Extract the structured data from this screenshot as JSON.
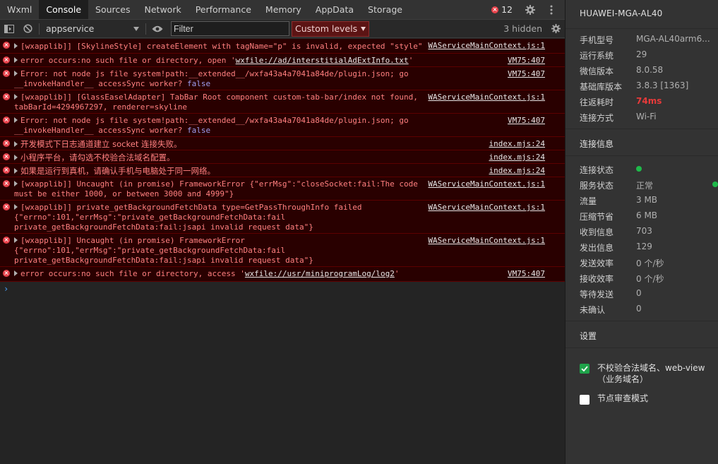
{
  "tabs": [
    "Wxml",
    "Console",
    "Sources",
    "Network",
    "Performance",
    "Memory",
    "AppData",
    "Storage"
  ],
  "active_tab": "Console",
  "error_count": "12",
  "toolbar": {
    "context": "appservice",
    "filter_placeholder": "Filter",
    "levels_label": "Custom levels",
    "hidden_label": "3 hidden"
  },
  "console": {
    "rows": [
      {
        "msg": "[wxapplib]] [SkylineStyle] createElement with tagName=\"p\" is invalid, expected \"style\"",
        "source": "WAServiceMainContext.js:1"
      },
      {
        "msg_prefix": "error occurs:no such file or directory, open '",
        "link": "wxfile://ad/interstitialAdExtInfo.txt",
        "msg_suffix": "'",
        "source": "VM75:407"
      },
      {
        "msg": "Error: not node js file system!path:__extended__/wxfa43a4a7041a84de/plugin.json; go __invokeHandler__ accessSync worker? ",
        "kw": "false",
        "source": "VM75:407"
      },
      {
        "msg": "[wxapplib]] [GlassEaselAdapter] TabBar Root component custom-tab-bar/index not found, tabBarId=4294967297, renderer=skyline",
        "source": "WAServiceMainContext.js:1"
      },
      {
        "msg": "Error: not node js file system!path:__extended__/wxfa43a4a7041a84de/plugin.json; go __invokeHandler__ accessSync worker? ",
        "kw": "false",
        "source": "VM75:407"
      },
      {
        "msg": "开发模式下日志通道建立 socket 连接失败。",
        "source": "index.mjs:24"
      },
      {
        "msg": "小程序平台，请勾选不校验合法域名配置。",
        "source": "index.mjs:24"
      },
      {
        "msg": "如果是运行到真机，请确认手机与电脑处于同一网络。",
        "source": "index.mjs:24"
      },
      {
        "msg": "[wxapplib]] Uncaught (in promise) FrameworkError {\"errMsg\":\"closeSocket:fail:The code must be either 1000, or between 3000 and 4999\"}",
        "source": "WAServiceMainContext.js:1"
      },
      {
        "msg": "[wxapplib]] private_getBackgroundFetchData type=GetPassThroughInfo failed {\"errno\":101,\"errMsg\":\"private_getBackgroundFetchData:fail private_getBackgroundFetchData:fail:jsapi invalid request data\"}",
        "source": "WAServiceMainContext.js:1"
      },
      {
        "msg": "[wxapplib]] Uncaught (in promise) FrameworkError {\"errno\":101,\"errMsg\":\"private_getBackgroundFetchData:fail private_getBackgroundFetchData:fail:jsapi invalid request data\"}",
        "source": "WAServiceMainContext.js:1"
      },
      {
        "msg_prefix": "error occurs:no such file or directory, access '",
        "link": "wxfile://usr/miniprogramLog/log2",
        "msg_suffix": "'",
        "source": "VM75:407"
      }
    ],
    "prompt": "›"
  },
  "side": {
    "device": "HUAWEI-MGA-AL40",
    "info": [
      {
        "k": "手机型号",
        "v": "MGA-AL40arm6..."
      },
      {
        "k": "运行系统",
        "v": "29"
      },
      {
        "k": "微信版本",
        "v": "8.0.58"
      },
      {
        "k": "基础库版本",
        "v": "3.8.3 [1363]"
      },
      {
        "k": "往返耗时",
        "v": "74ms"
      },
      {
        "k": "连接方式",
        "v": "Wi-Fi"
      }
    ],
    "conn_title": "连接信息",
    "conn": [
      {
        "k": "连接状态",
        "v": ""
      },
      {
        "k": "服务状态",
        "v": "正常"
      },
      {
        "k": "流量",
        "v": "3 MB"
      },
      {
        "k": "压缩节省",
        "v": "6 MB"
      },
      {
        "k": "收到信息",
        "v": "703"
      },
      {
        "k": "发出信息",
        "v": "129"
      },
      {
        "k": "发送效率",
        "v": "0 个/秒"
      },
      {
        "k": "接收效率",
        "v": "0 个/秒"
      },
      {
        "k": "等待发送",
        "v": "0"
      },
      {
        "k": "未确认",
        "v": "0"
      }
    ],
    "settings_title": "设置",
    "opt1": "不校验合法域名、web-view（业务域名）",
    "opt2": "节点审查模式",
    "status_color": "#1fb94a",
    "rtt_color": "#e83a3a"
  }
}
